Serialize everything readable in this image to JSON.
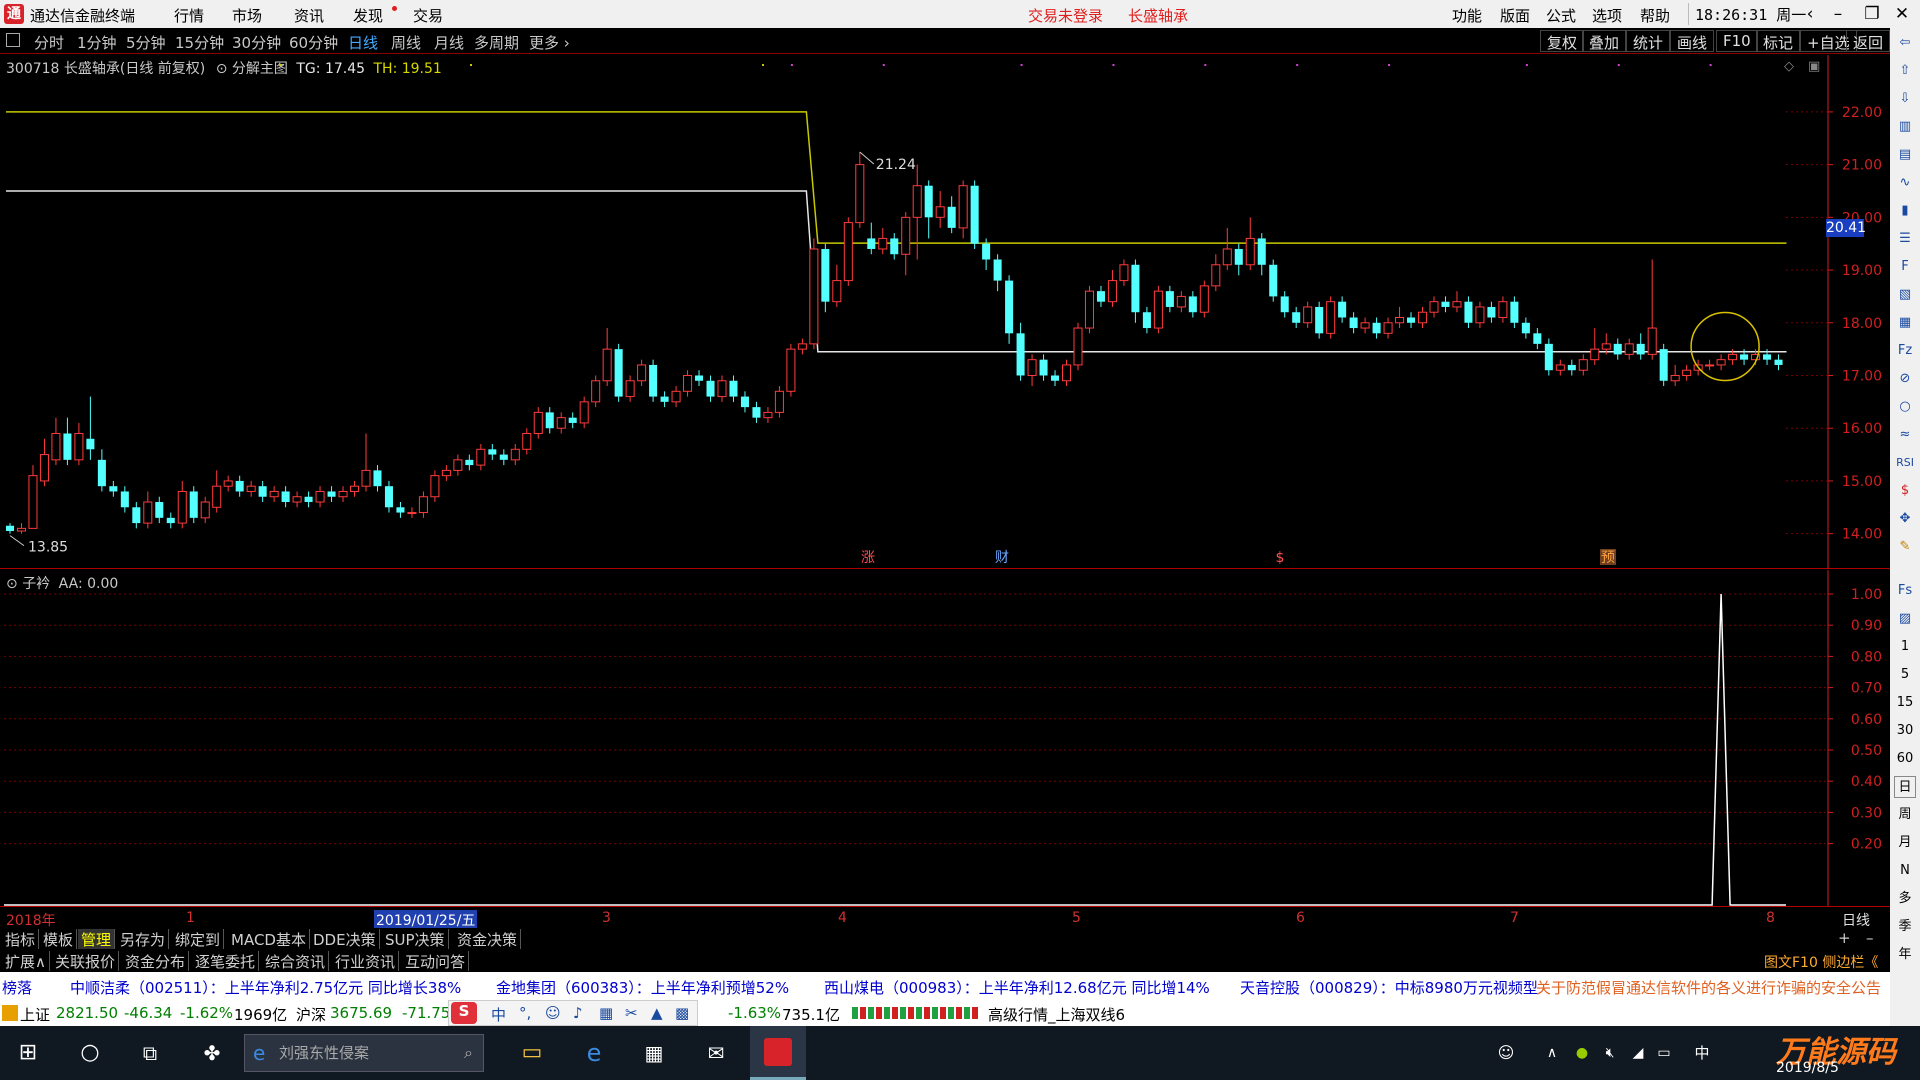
{
  "titlebar": {
    "app_name": "通达信金融终端",
    "menus": [
      "行情",
      "市场",
      "资讯",
      "发现",
      "交易"
    ],
    "status_login": "交易未登录",
    "stock_name": "长盛轴承",
    "right_menus": [
      "功能",
      "版面",
      "公式",
      "选项",
      "帮助"
    ],
    "clock": "18:26:31",
    "weekday": "周一"
  },
  "periods": {
    "items": [
      "分时",
      "1分钟",
      "5分钟",
      "15分钟",
      "30分钟",
      "60分钟",
      "日线",
      "周线",
      "月线",
      "多周期",
      "更多"
    ],
    "active": "日线",
    "right_items": [
      "复权",
      "叠加",
      "统计",
      "画线",
      "F10",
      "标记",
      "+自选",
      "返回"
    ]
  },
  "main_chart": {
    "code_title": "300718 长盛轴承(日线 前复权)",
    "indicator_name": "分解主图",
    "tg_label": "TG: 17.45",
    "th_label": "TH: 19.51",
    "price_axis": [
      "22.00",
      "21.00",
      "20.00",
      "19.00",
      "18.00",
      "17.00",
      "16.00",
      "15.00",
      "14.00"
    ],
    "current_price_tag": "20.41",
    "high_label": "21.24",
    "low_label": "13.85",
    "event_markers": [
      "涨",
      "财",
      "$",
      "预"
    ],
    "colors": {
      "up": "#ff3b3b",
      "down": "#54ffff",
      "th_line": "#c8c800",
      "tg_line": "#e6e6e6",
      "axis": "#d02020"
    }
  },
  "chart_data": {
    "type": "candlestick",
    "ohlc": [
      [
        14.15,
        14.05,
        14.2,
        14.0
      ],
      [
        14.05,
        14.1,
        14.2,
        14.0
      ],
      [
        14.1,
        15.1,
        15.3,
        14.1
      ],
      [
        15.0,
        15.5,
        15.8,
        14.9
      ],
      [
        15.4,
        15.9,
        16.2,
        15.3
      ],
      [
        15.9,
        15.4,
        16.2,
        15.3
      ],
      [
        15.4,
        15.9,
        16.1,
        15.3
      ],
      [
        15.8,
        15.6,
        16.6,
        15.4
      ],
      [
        15.4,
        14.9,
        15.6,
        14.8
      ],
      [
        14.9,
        14.8,
        15.0,
        14.7
      ],
      [
        14.8,
        14.5,
        14.9,
        14.4
      ],
      [
        14.5,
        14.2,
        14.6,
        14.1
      ],
      [
        14.2,
        14.6,
        14.8,
        14.1
      ],
      [
        14.6,
        14.3,
        14.7,
        14.2
      ],
      [
        14.3,
        14.2,
        14.4,
        14.1
      ],
      [
        14.2,
        14.8,
        15.0,
        14.1
      ],
      [
        14.8,
        14.3,
        14.9,
        14.2
      ],
      [
        14.3,
        14.6,
        14.7,
        14.2
      ],
      [
        14.5,
        14.9,
        15.2,
        14.4
      ],
      [
        14.9,
        15.0,
        15.1,
        14.8
      ],
      [
        15.0,
        14.8,
        15.1,
        14.7
      ],
      [
        14.8,
        14.9,
        15.0,
        14.7
      ],
      [
        14.9,
        14.7,
        15.0,
        14.6
      ],
      [
        14.7,
        14.8,
        14.9,
        14.6
      ],
      [
        14.8,
        14.6,
        14.9,
        14.5
      ],
      [
        14.6,
        14.7,
        14.8,
        14.5
      ],
      [
        14.7,
        14.6,
        14.8,
        14.5
      ],
      [
        14.6,
        14.8,
        14.9,
        14.5
      ],
      [
        14.8,
        14.7,
        14.9,
        14.6
      ],
      [
        14.7,
        14.8,
        14.9,
        14.6
      ],
      [
        14.8,
        14.9,
        15.0,
        14.7
      ],
      [
        14.9,
        15.2,
        15.9,
        14.8
      ],
      [
        15.2,
        14.9,
        15.3,
        14.8
      ],
      [
        14.9,
        14.5,
        15.0,
        14.4
      ],
      [
        14.5,
        14.4,
        14.6,
        14.3
      ],
      [
        14.4,
        14.4,
        14.5,
        14.3
      ],
      [
        14.4,
        14.7,
        14.8,
        14.3
      ],
      [
        14.7,
        15.1,
        15.2,
        14.6
      ],
      [
        15.1,
        15.2,
        15.3,
        15.0
      ],
      [
        15.2,
        15.4,
        15.5,
        15.1
      ],
      [
        15.4,
        15.3,
        15.5,
        15.2
      ],
      [
        15.3,
        15.6,
        15.7,
        15.2
      ],
      [
        15.6,
        15.5,
        15.7,
        15.4
      ],
      [
        15.5,
        15.4,
        15.6,
        15.3
      ],
      [
        15.4,
        15.6,
        15.7,
        15.3
      ],
      [
        15.6,
        15.9,
        16.0,
        15.5
      ],
      [
        15.9,
        16.3,
        16.4,
        15.8
      ],
      [
        16.3,
        16.0,
        16.4,
        15.9
      ],
      [
        16.0,
        16.2,
        16.3,
        15.9
      ],
      [
        16.2,
        16.1,
        16.3,
        16.0
      ],
      [
        16.1,
        16.5,
        16.6,
        16.0
      ],
      [
        16.5,
        16.9,
        17.0,
        16.4
      ],
      [
        16.9,
        17.5,
        17.9,
        16.8
      ],
      [
        17.5,
        16.6,
        17.6,
        16.5
      ],
      [
        16.6,
        16.9,
        17.0,
        16.5
      ],
      [
        16.9,
        17.2,
        17.3,
        16.8
      ],
      [
        17.2,
        16.6,
        17.3,
        16.5
      ],
      [
        16.6,
        16.5,
        16.7,
        16.4
      ],
      [
        16.5,
        16.7,
        16.8,
        16.4
      ],
      [
        16.7,
        17.0,
        17.1,
        16.6
      ],
      [
        17.0,
        16.9,
        17.1,
        16.8
      ],
      [
        16.9,
        16.6,
        17.0,
        16.5
      ],
      [
        16.6,
        16.9,
        17.0,
        16.5
      ],
      [
        16.9,
        16.6,
        17.0,
        16.5
      ],
      [
        16.6,
        16.4,
        16.7,
        16.3
      ],
      [
        16.4,
        16.2,
        16.5,
        16.1
      ],
      [
        16.2,
        16.3,
        16.4,
        16.1
      ],
      [
        16.3,
        16.7,
        16.8,
        16.2
      ],
      [
        16.7,
        17.5,
        17.6,
        16.6
      ],
      [
        17.5,
        17.6,
        17.7,
        17.4
      ],
      [
        17.6,
        19.4,
        19.6,
        17.5
      ],
      [
        19.4,
        18.4,
        19.5,
        18.2
      ],
      [
        18.4,
        18.8,
        19.1,
        18.3
      ],
      [
        18.8,
        19.9,
        20.0,
        18.7
      ],
      [
        19.9,
        21.0,
        21.24,
        19.8
      ],
      [
        19.6,
        19.4,
        19.9,
        19.3
      ],
      [
        19.4,
        19.6,
        19.8,
        19.3
      ],
      [
        19.6,
        19.3,
        19.7,
        19.2
      ],
      [
        19.3,
        20.0,
        20.1,
        18.9
      ],
      [
        20.0,
        20.6,
        21.0,
        19.2
      ],
      [
        20.6,
        20.0,
        20.7,
        19.6
      ],
      [
        20.0,
        20.2,
        20.5,
        19.8
      ],
      [
        20.2,
        19.8,
        20.4,
        19.7
      ],
      [
        19.8,
        20.6,
        20.7,
        19.6
      ],
      [
        20.6,
        19.5,
        20.7,
        19.4
      ],
      [
        19.5,
        19.2,
        19.6,
        19.0
      ],
      [
        19.2,
        18.8,
        19.3,
        18.6
      ],
      [
        18.8,
        17.8,
        18.9,
        17.6
      ],
      [
        17.8,
        17.0,
        18.0,
        16.9
      ],
      [
        17.0,
        17.3,
        17.4,
        16.8
      ],
      [
        17.3,
        17.0,
        17.4,
        16.9
      ],
      [
        17.0,
        16.9,
        17.1,
        16.8
      ],
      [
        16.9,
        17.2,
        17.3,
        16.8
      ],
      [
        17.2,
        17.9,
        18.0,
        17.1
      ],
      [
        17.9,
        18.6,
        18.7,
        17.8
      ],
      [
        18.6,
        18.4,
        18.7,
        18.3
      ],
      [
        18.4,
        18.8,
        19.0,
        18.3
      ],
      [
        18.8,
        19.1,
        19.2,
        18.7
      ],
      [
        19.1,
        18.2,
        19.2,
        18.0
      ],
      [
        18.2,
        17.9,
        18.3,
        17.8
      ],
      [
        17.9,
        18.6,
        18.7,
        17.8
      ],
      [
        18.6,
        18.3,
        18.7,
        18.2
      ],
      [
        18.3,
        18.5,
        18.6,
        18.2
      ],
      [
        18.5,
        18.2,
        18.6,
        18.1
      ],
      [
        18.2,
        18.7,
        18.8,
        18.1
      ],
      [
        18.7,
        19.1,
        19.3,
        18.6
      ],
      [
        19.1,
        19.4,
        19.8,
        19.0
      ],
      [
        19.4,
        19.1,
        19.5,
        18.9
      ],
      [
        19.1,
        19.6,
        20.0,
        19.0
      ],
      [
        19.6,
        19.1,
        19.7,
        18.9
      ],
      [
        19.1,
        18.5,
        19.2,
        18.4
      ],
      [
        18.5,
        18.2,
        18.6,
        18.1
      ],
      [
        18.2,
        18.0,
        18.3,
        17.9
      ],
      [
        18.0,
        18.3,
        18.4,
        17.9
      ],
      [
        18.3,
        17.8,
        18.4,
        17.7
      ],
      [
        17.8,
        18.4,
        18.5,
        17.7
      ],
      [
        18.4,
        18.1,
        18.5,
        18.0
      ],
      [
        18.1,
        17.9,
        18.2,
        17.8
      ],
      [
        17.9,
        18.0,
        18.1,
        17.8
      ],
      [
        18.0,
        17.8,
        18.1,
        17.7
      ],
      [
        17.8,
        18.0,
        18.1,
        17.7
      ],
      [
        18.0,
        18.1,
        18.3,
        17.9
      ],
      [
        18.1,
        18.0,
        18.2,
        17.9
      ],
      [
        18.0,
        18.2,
        18.3,
        17.9
      ],
      [
        18.2,
        18.4,
        18.5,
        18.1
      ],
      [
        18.4,
        18.3,
        18.5,
        18.2
      ],
      [
        18.3,
        18.4,
        18.6,
        18.2
      ],
      [
        18.4,
        18.0,
        18.5,
        17.9
      ],
      [
        18.0,
        18.3,
        18.4,
        17.9
      ],
      [
        18.3,
        18.1,
        18.4,
        18.0
      ],
      [
        18.1,
        18.4,
        18.5,
        18.0
      ],
      [
        18.4,
        18.0,
        18.5,
        17.9
      ],
      [
        18.0,
        17.8,
        18.1,
        17.7
      ],
      [
        17.8,
        17.6,
        17.9,
        17.5
      ],
      [
        17.6,
        17.1,
        17.7,
        17.0
      ],
      [
        17.1,
        17.2,
        17.3,
        17.0
      ],
      [
        17.2,
        17.1,
        17.3,
        17.0
      ],
      [
        17.1,
        17.3,
        17.4,
        17.0
      ],
      [
        17.3,
        17.5,
        17.9,
        17.2
      ],
      [
        17.5,
        17.6,
        17.8,
        17.4
      ],
      [
        17.6,
        17.4,
        17.7,
        17.3
      ],
      [
        17.4,
        17.6,
        17.7,
        17.3
      ],
      [
        17.6,
        17.4,
        17.8,
        17.3
      ],
      [
        17.4,
        17.9,
        19.2,
        17.3
      ],
      [
        17.5,
        16.9,
        17.6,
        16.8
      ],
      [
        16.9,
        17.0,
        17.2,
        16.8
      ],
      [
        17.0,
        17.1,
        17.2,
        16.9
      ],
      [
        17.1,
        17.2,
        17.3,
        17.0
      ],
      [
        17.2,
        17.2,
        17.3,
        17.1
      ],
      [
        17.2,
        17.3,
        17.4,
        17.1
      ],
      [
        17.3,
        17.4,
        17.5,
        17.2
      ],
      [
        17.4,
        17.3,
        17.5,
        17.2
      ],
      [
        17.3,
        17.4,
        17.5,
        17.2
      ],
      [
        17.4,
        17.3,
        17.5,
        17.2
      ],
      [
        17.3,
        17.2,
        17.4,
        17.1
      ]
    ],
    "ylim": [
      13.5,
      22.7
    ],
    "th_line": {
      "value_before": 22.0,
      "value_after": 19.51,
      "break_index": 70
    },
    "tg_line": {
      "value_before": 20.5,
      "value_after": 17.45,
      "break_index": 70
    },
    "annotations": {
      "high": 21.24,
      "low": 13.85
    },
    "sub_indicator": {
      "type": "line",
      "name": "子衿",
      "ylim": [
        0,
        1.0
      ],
      "spike_index": 149,
      "spike_value": 1.0
    }
  },
  "sub_chart": {
    "title": "子衿",
    "value_label": "AA: 0.00",
    "axis": [
      "1.00",
      "0.90",
      "0.80",
      "0.70",
      "0.60",
      "0.50",
      "0.40",
      "0.30",
      "0.20"
    ]
  },
  "time_axis": {
    "labels": [
      "2018年",
      "1",
      "2019/01/25/五",
      "3",
      "4",
      "5",
      "6",
      "7",
      "8"
    ],
    "period_label": "日线"
  },
  "tabs1": [
    "指标",
    "模板",
    "管理",
    "另存为",
    "绑定到",
    "MACD基本",
    "DDE决策",
    "SUP决策",
    "资金决策"
  ],
  "tabs1_active": "管理",
  "tabs2": [
    "扩展∧",
    "关联报价",
    "资金分布",
    "逐笔委托",
    "综合资讯",
    "行业资讯",
    "互动问答"
  ],
  "tabs2_right": "图文F10 侧边栏《",
  "ticker": [
    "榜落",
    "中顺洁柔（002511）：上半年净利2.75亿元  同比增长38%",
    "金地集团（600383）：上半年净利预增52%",
    "西山煤电（000983）：上半年净利12.68亿元  同比增14%",
    "天音控股（000829）：中标8980万元视频型",
    "关于防范假冒通达信软件的各义进行诈骗的安全公告"
  ],
  "indexbar": {
    "sh_name": "上证",
    "sh_val": "2821.50",
    "sh_chg": "-46.34",
    "sh_pct": "-1.62%",
    "sh_amt": "1969亿",
    "hs_name": "沪深",
    "hs_val": "3675.69",
    "hs_chg": "-71.75",
    "cy_pct": "-1.63%",
    "cy_amt": "735.1亿",
    "text": "高级行情_上海双线6"
  },
  "taskbar": {
    "search_placeholder": "刘强东性侵案",
    "date": "2019/8/5",
    "ime": "中",
    "watermark": "万能源码"
  }
}
